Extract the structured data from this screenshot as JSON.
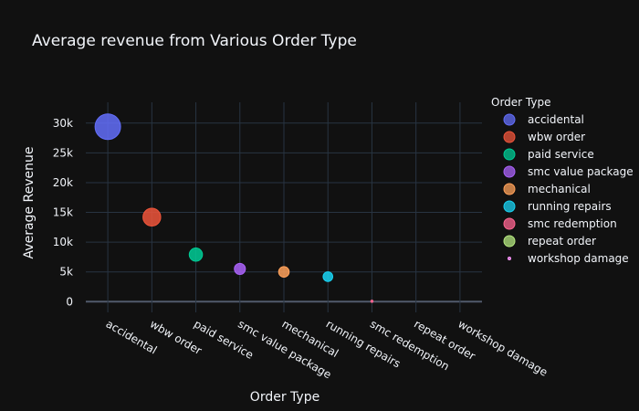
{
  "chart_data": {
    "type": "scatter",
    "title": "Average revenue from Various Order Type",
    "xlabel": "Order Type",
    "ylabel": "Average Revenue",
    "categories": [
      "accidental",
      "wbw order",
      "paid service",
      "smc value package",
      "mechanical",
      "running repairs",
      "smc redemption",
      "repeat order",
      "workshop damage"
    ],
    "y_ticks": [
      {
        "value": 0,
        "label": "0"
      },
      {
        "value": 5000,
        "label": "5k"
      },
      {
        "value": 10000,
        "label": "10k"
      },
      {
        "value": 15000,
        "label": "15k"
      },
      {
        "value": 20000,
        "label": "20k"
      },
      {
        "value": 25000,
        "label": "25k"
      },
      {
        "value": 30000,
        "label": "30k"
      }
    ],
    "ylim": [
      -1800,
      33500
    ],
    "grid": true,
    "legend_title": "Order Type",
    "legend_position": "right",
    "series": [
      {
        "name": "accidental",
        "x": "accidental",
        "y": 29400,
        "color": "#636efa"
      },
      {
        "name": "wbw order",
        "x": "wbw order",
        "y": 14200,
        "color": "#ef553b"
      },
      {
        "name": "paid service",
        "x": "paid service",
        "y": 7900,
        "color": "#00cc96"
      },
      {
        "name": "smc value package",
        "x": "smc value package",
        "y": 5500,
        "color": "#ab63fa"
      },
      {
        "name": "mechanical",
        "x": "mechanical",
        "y": 5000,
        "color": "#ffa15a"
      },
      {
        "name": "running repairs",
        "x": "running repairs",
        "y": 4200,
        "color": "#19d3f3"
      },
      {
        "name": "smc redemption",
        "x": "smc redemption",
        "y": 60,
        "color": "#ff6692"
      },
      {
        "name": "repeat order",
        "x": "repeat order",
        "y": 0,
        "color": "#b6e880"
      },
      {
        "name": "workshop damage",
        "x": "workshop damage",
        "y": 0,
        "color": "#ff97ff"
      }
    ]
  }
}
